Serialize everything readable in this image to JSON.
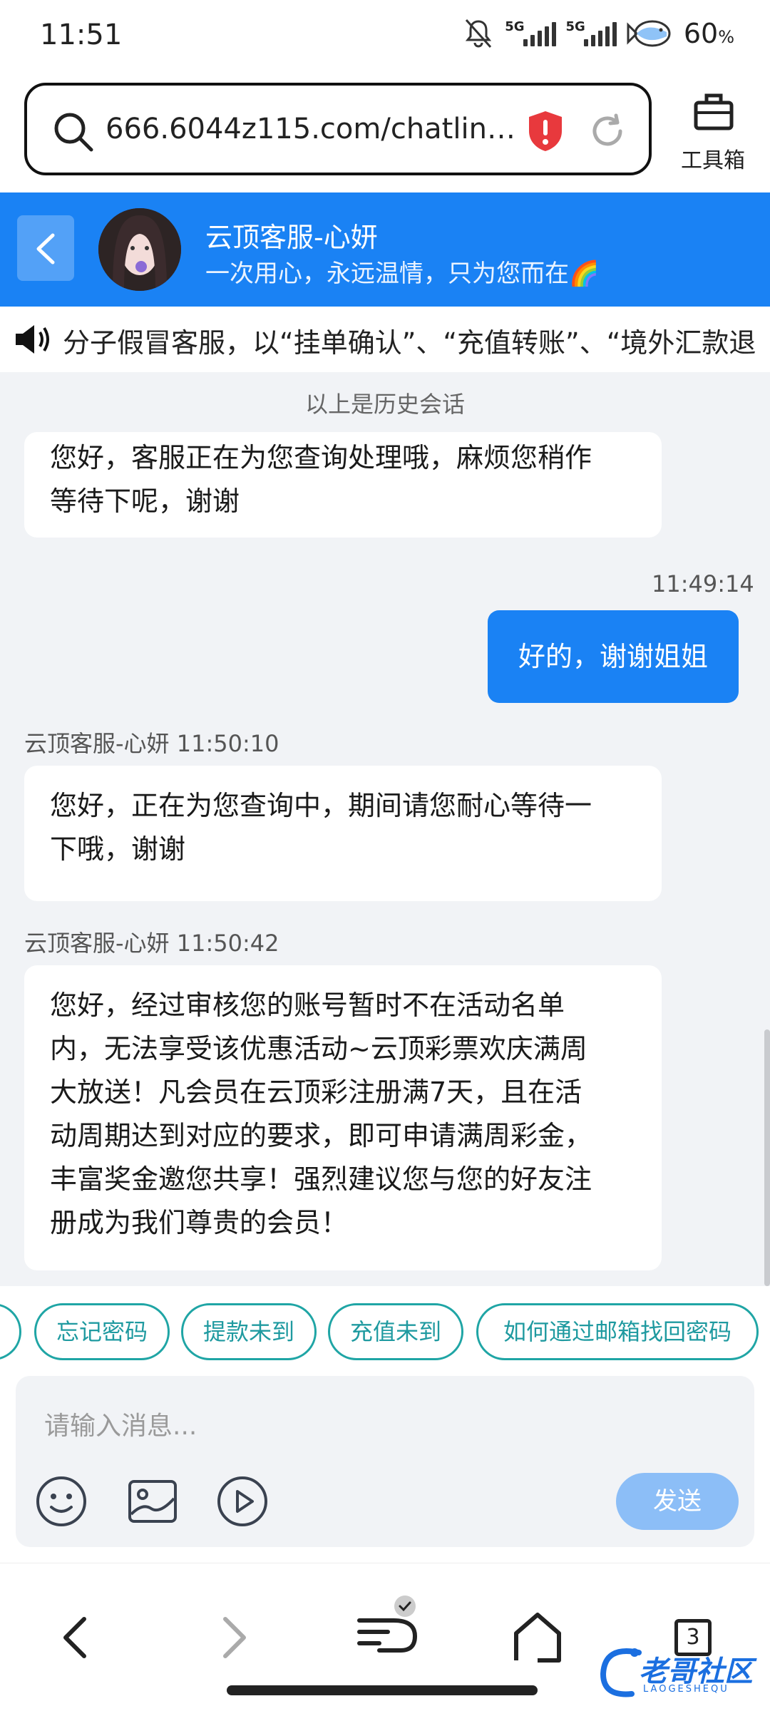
{
  "status_bar": {
    "time": "11:51",
    "network_1": "5G",
    "network_2": "5G",
    "battery": "60",
    "battery_unit": "%"
  },
  "browser": {
    "url": "666.6044z115.com/chatlin…",
    "toolbox_label": "工具箱"
  },
  "chat_header": {
    "agent_name": "云顶客服-心妍",
    "slogan": "一次用心，永远温情，只为您而在🌈"
  },
  "notice": {
    "text": "分子假冒客服，以“挂单确认”、“充值转账”、“境外汇款退"
  },
  "chat": {
    "history_divider": "以上是历史会话",
    "messages": [
      {
        "side": "left",
        "text_lines": [
          "您好，客服正在为您查询处理哦，麻烦您稍作",
          "等待下呢，谢谢"
        ]
      },
      {
        "side": "right",
        "time": "11:49:14",
        "text": "好的，谢谢姐姐"
      },
      {
        "side": "left",
        "meta": "云顶客服-心妍 11:50:10",
        "text_lines": [
          "您好，正在为您查询中，期间请您耐心等待一",
          "下哦，谢谢"
        ]
      },
      {
        "side": "left",
        "meta": "云顶客服-心妍 11:50:42",
        "text_lines": [
          "您好，经过审核您的账号暂时不在活动名单",
          "内，无法享受该优惠活动~云顶彩票欢庆满周",
          "大放送！凡会员在云顶彩注册满7天，且在活",
          "动周期达到对应的要求，即可申请满周彩金，",
          "丰富奖金邀您共享！强烈建议您与您的好友注",
          "册成为我们尊贵的会员！"
        ]
      }
    ]
  },
  "quick_replies": [
    "忘记密码",
    "提款未到",
    "充值未到",
    "如何通过邮箱找回密码"
  ],
  "composer": {
    "placeholder": "请输入消息...",
    "send_label": "发送"
  },
  "bottom_nav": {
    "tabs_count": "3"
  },
  "watermark": {
    "title": "老哥社区",
    "subtitle": "LAOGESHEQU"
  },
  "colors": {
    "brand_blue": "#1a82f4",
    "chip_teal": "#1fa5a5",
    "send_disabled": "#8cbef7"
  }
}
